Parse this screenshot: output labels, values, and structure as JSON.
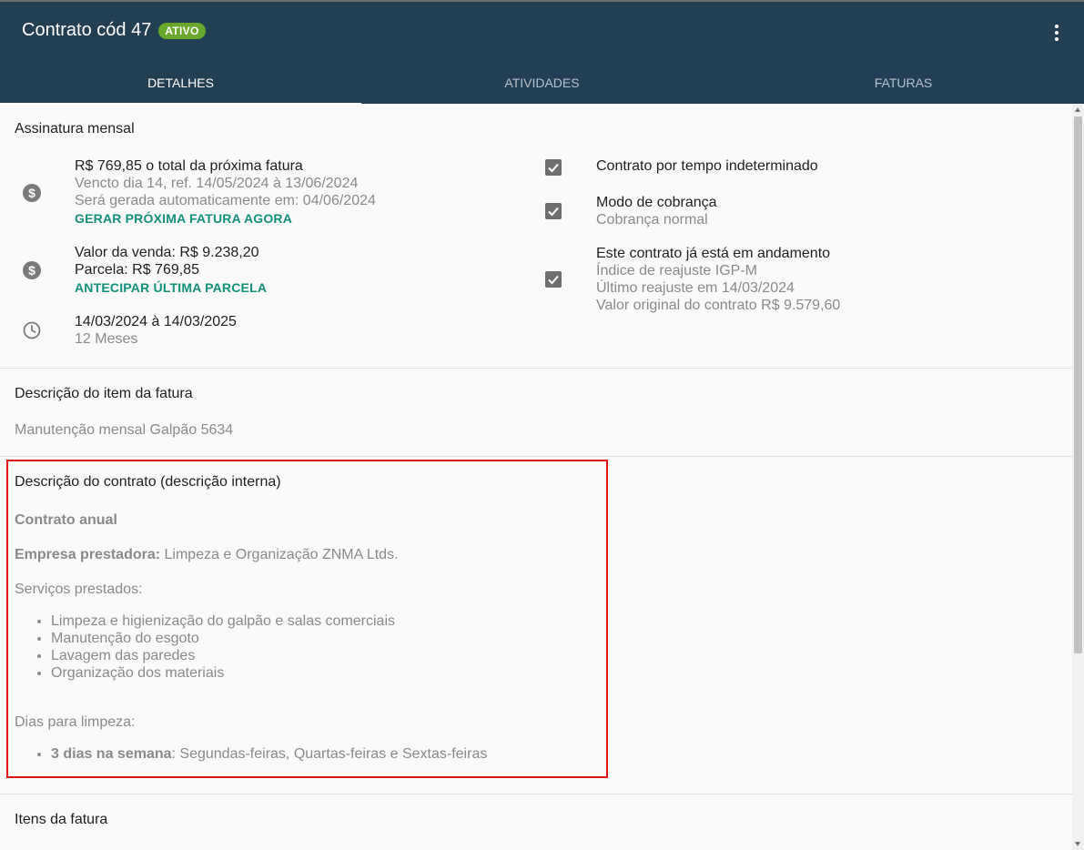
{
  "header": {
    "title": "Contrato cód 47",
    "status_badge": "ATIVO",
    "tabs": [
      {
        "label": "DETALHES",
        "active": true
      },
      {
        "label": "ATIVIDADES",
        "active": false
      },
      {
        "label": "FATURAS",
        "active": false
      }
    ]
  },
  "colors": {
    "header_bg": "#233f54",
    "badge_bg": "#6aa82c",
    "action_link": "#13907a",
    "highlight_border": "#e01010"
  },
  "assinatura": {
    "title": "Assinatura mensal",
    "invoice": {
      "icon": "dollar-icon",
      "line1": "R$ 769,85 o total da próxima fatura",
      "line2": "Vencto dia 14, ref. 14/05/2024 à 13/06/2024",
      "line3": "Será gerada automaticamente em: 04/06/2024",
      "action": "GERAR PRÓXIMA FATURA AGORA"
    },
    "sale": {
      "icon": "dollar-icon",
      "line1": "Valor da venda: R$ 9.238,20",
      "line2": "Parcela: R$ 769,85",
      "action": "ANTECIPAR ÚLTIMA PARCELA"
    },
    "period": {
      "icon": "clock-icon",
      "line1": "14/03/2024 à 14/03/2025",
      "line2": "12 Meses"
    },
    "checks": [
      {
        "label": "Contrato por tempo indeterminado",
        "checked": true
      },
      {
        "label": "Modo de cobrança",
        "sub": "Cobrança normal",
        "checked": true
      },
      {
        "label": "Este contrato já está em andamento",
        "sub1": "Índice de reajuste IGP-M",
        "sub2": "Último reajuste em 14/03/2024",
        "sub3": "Valor original do contrato R$ 9.579,60",
        "checked": true
      }
    ]
  },
  "item_desc": {
    "title": "Descrição do item da fatura",
    "text": "Manutenção mensal Galpão 5634"
  },
  "contract_desc": {
    "title": "Descrição do contrato (descrição interna)",
    "heading": "Contrato anual",
    "company_label": "Empresa prestadora:",
    "company_value": " Limpeza e Organização ZNMA Ltds.",
    "services_label": "Serviços prestados:",
    "services": [
      "Limpeza e higienização do galpão e salas comerciais",
      "Manutenção do esgoto",
      "Lavagem das paredes",
      "Organização dos materiais"
    ],
    "days_label": "Dias para limpeza:",
    "days_bold": "3 dias na semana",
    "days_value": ": Segundas-feiras, Quartas-feiras e Sextas-feiras"
  },
  "invoice_items": {
    "title": "Itens da fatura"
  }
}
